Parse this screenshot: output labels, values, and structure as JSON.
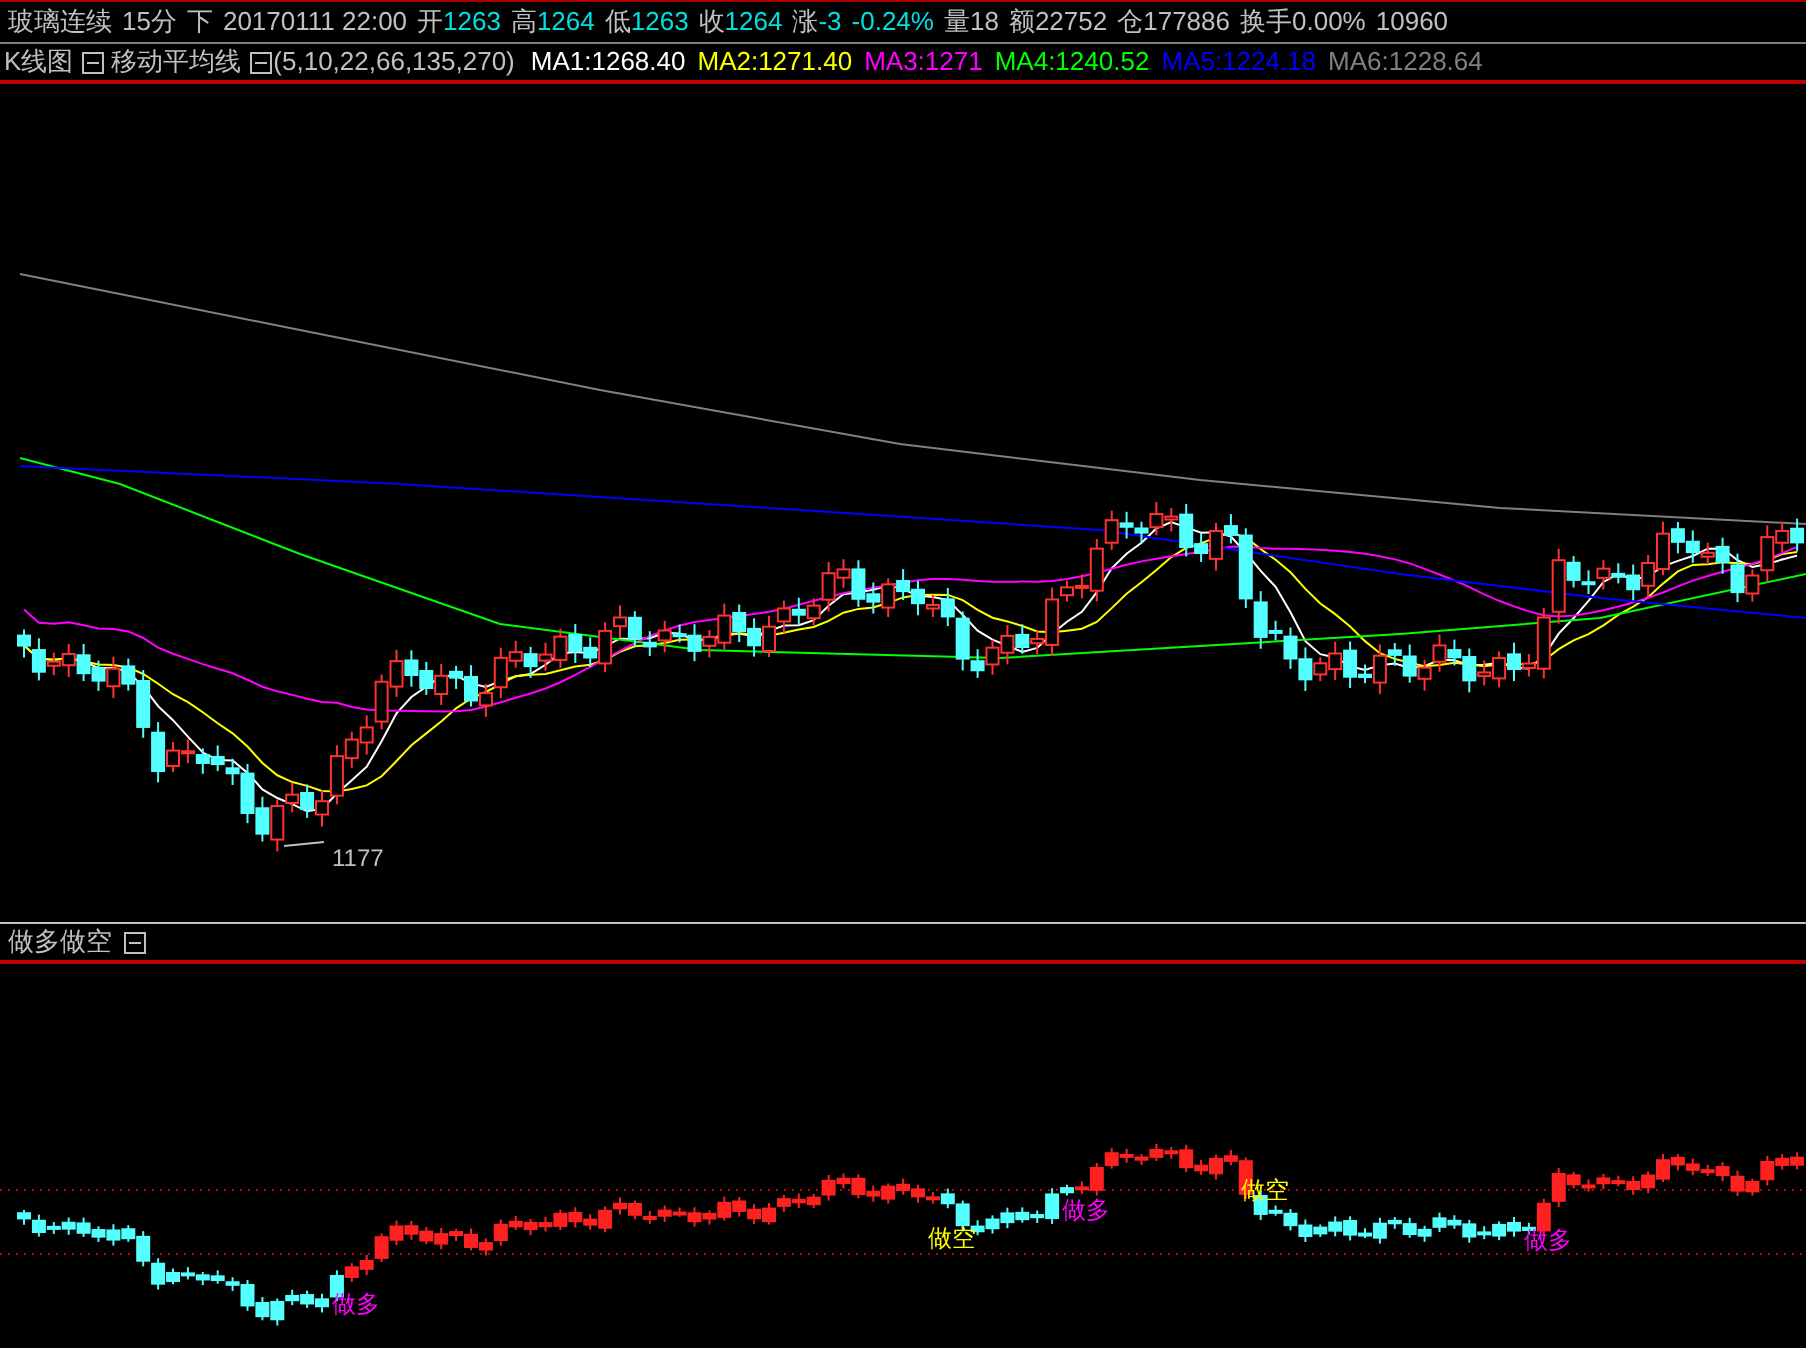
{
  "quote_bar": {
    "symbol": "玻璃连续",
    "period": "15分",
    "direction": "下",
    "datetime": "20170111 22:00",
    "fields": [
      {
        "label": "开",
        "value": "1263",
        "kind": "price"
      },
      {
        "label": "高",
        "value": "1264",
        "kind": "price"
      },
      {
        "label": "低",
        "value": "1263",
        "kind": "price"
      },
      {
        "label": "收",
        "value": "1264",
        "kind": "price"
      },
      {
        "label": "涨",
        "value": "-3",
        "kind": "change"
      },
      {
        "value": "-0.24%",
        "kind": "change"
      },
      {
        "label": "量",
        "value": "18",
        "kind": "stat"
      },
      {
        "label": "额",
        "value": "22752",
        "kind": "stat"
      },
      {
        "label": "仓",
        "value": "177886",
        "kind": "stat"
      },
      {
        "label": "换手",
        "value": "0.00%",
        "kind": "stat"
      },
      {
        "value": "10960",
        "kind": "stat"
      }
    ]
  },
  "main_chart": {
    "title": "K线图",
    "indicator": "移动平均线",
    "params": "(5,10,22,66,135,270)",
    "moving_averages": [
      {
        "label": "MA1:1268.40",
        "color": "#ffffff"
      },
      {
        "label": "MA2:1271.40",
        "color": "#ffff00"
      },
      {
        "label": "MA3:1271",
        "color": "#ff00ff"
      },
      {
        "label": "MA4:1240.52",
        "color": "#00ff00"
      },
      {
        "label": "MA5:1224.18",
        "color": "#0000ff"
      },
      {
        "label": "MA6:1228.64",
        "color": "#808080"
      }
    ],
    "low_label": "1177"
  },
  "sub_chart": {
    "title": "做多做空",
    "signals": [
      {
        "text": "做多",
        "kind": "long"
      },
      {
        "text": "做空",
        "kind": "short"
      },
      {
        "text": "做多",
        "kind": "long"
      },
      {
        "text": "做空",
        "kind": "short"
      },
      {
        "text": "做多",
        "kind": "long"
      }
    ]
  }
}
